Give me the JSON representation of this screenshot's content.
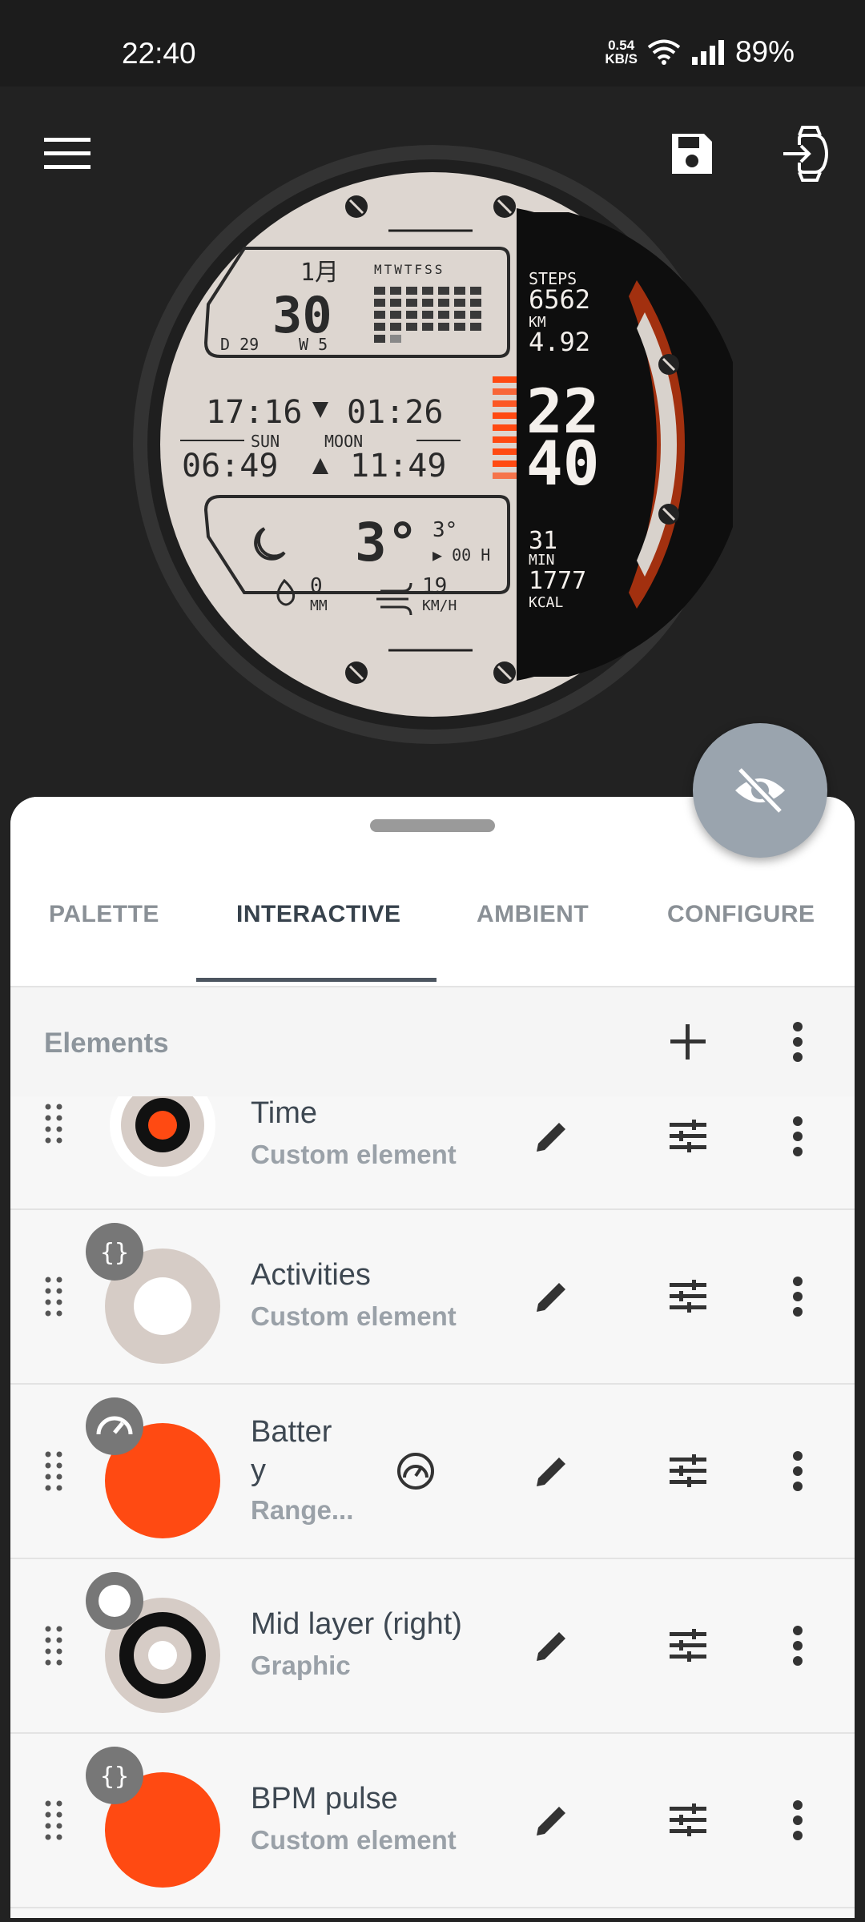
{
  "status": {
    "time": "22:40",
    "net_speed_value": "0.54",
    "net_speed_unit": "KB/S",
    "battery": "89%"
  },
  "header": {
    "menu_icon": "hamburger-menu-icon",
    "save_icon": "save-disk-icon",
    "send_icon": "send-to-watch-icon"
  },
  "watch": {
    "month": "1月",
    "day": "30",
    "weekdays": "MTWTFSS",
    "day_of_year": "D 29",
    "week": "W 5",
    "sunrise": "17:16",
    "moonrise": "01:26",
    "sunset": "06:49",
    "moonset": "11:49",
    "sun_label": "SUN",
    "moon_label": "MOON",
    "steps_label": "STEPS",
    "steps": "6562",
    "km_label": "KM",
    "km": "4.92",
    "hour": "22",
    "minute": "40",
    "min_value": "31",
    "min_label": "MIN",
    "kcal": "1777",
    "kcal_label": "KCAL",
    "temp": "3°",
    "temp_small": "3°",
    "temp_time": "▶ 00 H",
    "rain": "0",
    "rain_unit": "MM",
    "wind": "19",
    "wind_unit": "KM/H",
    "accent_color": "#ff4a12"
  },
  "tabs": [
    {
      "label": "PALETTE"
    },
    {
      "label": "INTERACTIVE"
    },
    {
      "label": "AMBIENT"
    },
    {
      "label": "CONFIGURE"
    }
  ],
  "elements": {
    "title": "Elements",
    "items": [
      {
        "title": "Time",
        "subtitle": "Custom element"
      },
      {
        "title": "Activities",
        "subtitle": "Custom element"
      },
      {
        "title_line1": "Batter",
        "title_line2": "y",
        "subtitle": "Range..."
      },
      {
        "title": "Mid layer (right)",
        "subtitle": "Graphic"
      },
      {
        "title": "BPM pulse",
        "subtitle": "Custom element"
      }
    ]
  },
  "fab": {
    "icon": "eye-off-icon"
  }
}
